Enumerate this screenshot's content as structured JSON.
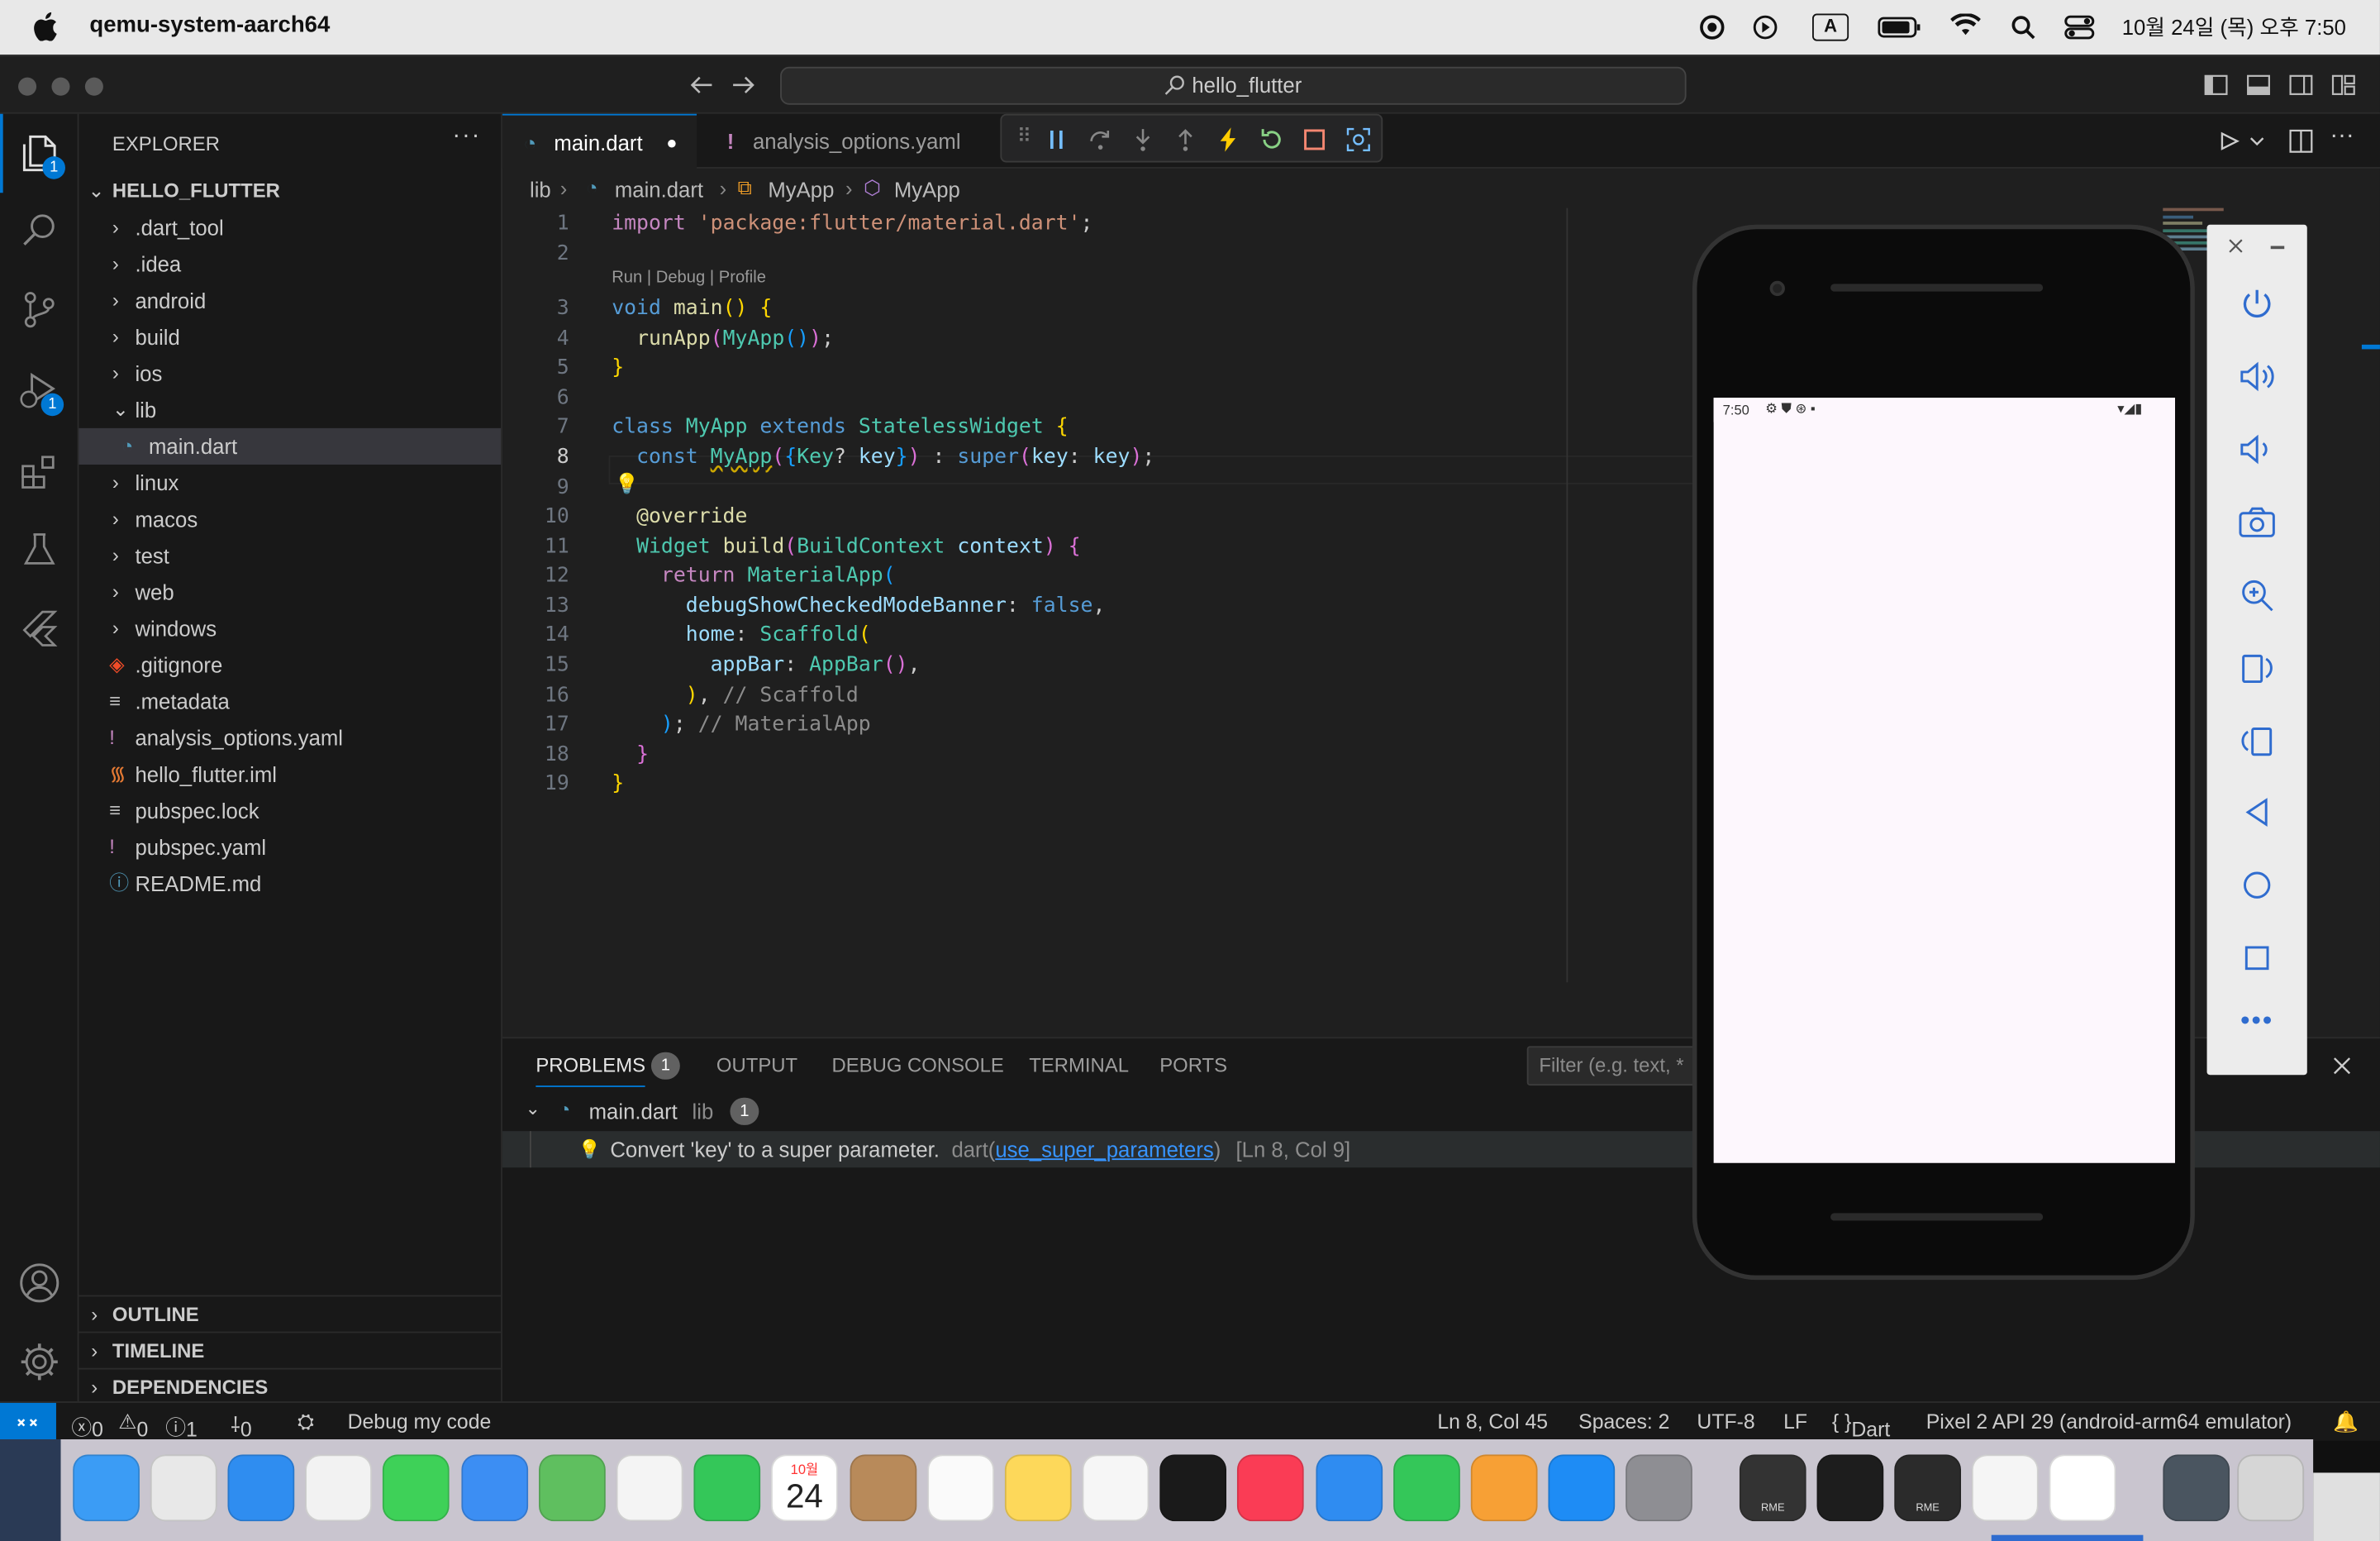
{
  "menubar": {
    "app_name": "qemu-system-aarch64",
    "clock": "10월 24일 (목) 오후 7:50",
    "input_indicator": "A"
  },
  "window": {
    "search_text": "hello_flutter"
  },
  "activity": {
    "explorer_badge": "1",
    "debug_badge": "1"
  },
  "explorer": {
    "header": "EXPLORER",
    "root": "HELLO_FLUTTER",
    "items": [
      {
        "label": ".dart_tool",
        "kind": "folder"
      },
      {
        "label": ".idea",
        "kind": "folder"
      },
      {
        "label": "android",
        "kind": "folder"
      },
      {
        "label": "build",
        "kind": "folder"
      },
      {
        "label": "ios",
        "kind": "folder"
      },
      {
        "label": "lib",
        "kind": "folder-open"
      },
      {
        "label": "main.dart",
        "kind": "dart"
      },
      {
        "label": "linux",
        "kind": "folder"
      },
      {
        "label": "macos",
        "kind": "folder"
      },
      {
        "label": "test",
        "kind": "folder"
      },
      {
        "label": "web",
        "kind": "folder"
      },
      {
        "label": "windows",
        "kind": "folder"
      },
      {
        "label": ".gitignore",
        "kind": "git"
      },
      {
        "label": ".metadata",
        "kind": "lines"
      },
      {
        "label": "analysis_options.yaml",
        "kind": "yaml"
      },
      {
        "label": "hello_flutter.iml",
        "kind": "rss"
      },
      {
        "label": "pubspec.lock",
        "kind": "lines"
      },
      {
        "label": "pubspec.yaml",
        "kind": "yaml"
      },
      {
        "label": "README.md",
        "kind": "info"
      }
    ],
    "sections": [
      "OUTLINE",
      "TIMELINE",
      "DEPENDENCIES"
    ]
  },
  "tabs": [
    {
      "label": "main.dart",
      "active": true,
      "dirty": true
    },
    {
      "label": "analysis_options.yaml",
      "active": false
    }
  ],
  "breadcrumb": {
    "folder": "lib",
    "file": "main.dart",
    "class1": "MyApp",
    "class2": "MyApp"
  },
  "codelens": "Run | Debug | Profile",
  "panel": {
    "tabs": [
      "PROBLEMS",
      "OUTPUT",
      "DEBUG CONSOLE",
      "TERMINAL",
      "PORTS"
    ],
    "problems_count": "1",
    "filter_placeholder": "Filter (e.g. text, *",
    "file": "main.dart",
    "file_dir": "lib",
    "file_count": "1",
    "message": "Convert 'key' to a super parameter.",
    "source": "dart(",
    "rule": "use_super_parameters",
    "source_close": ")",
    "location": "[Ln 8, Col 9]"
  },
  "status": {
    "errors": "0",
    "warnings": "0",
    "infos": "1",
    "ports": "0",
    "debug": "Debug my code",
    "pos": "Ln 8, Col 45",
    "spaces": "Spaces: 2",
    "encoding": "UTF-8",
    "eol": "LF",
    "lang": "Dart",
    "device": "Pixel 2 API 29 (android-arm64 emulator)"
  },
  "emulator": {
    "time": "7:50"
  },
  "dock": {
    "calendar_month": "10월",
    "calendar_day": "24",
    "app_label_1": "RME",
    "app_label_2": "RME"
  }
}
